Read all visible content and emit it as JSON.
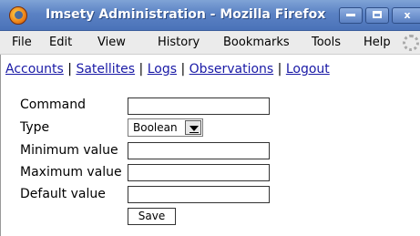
{
  "window": {
    "title": "Imsety Administration - Mozilla Firefox",
    "controls": [
      "minimize-icon",
      "maximize-icon",
      "close-icon"
    ],
    "close_glyph": "x"
  },
  "menubar": {
    "items": [
      "File",
      "Edit",
      "View",
      "History",
      "Bookmarks",
      "Tools",
      "Help"
    ]
  },
  "nav": {
    "links": [
      "Accounts",
      "Satellites",
      "Logs",
      "Observations",
      "Logout"
    ],
    "separator": "|"
  },
  "form": {
    "command_label": "Command",
    "command_value": "",
    "type_label": "Type",
    "type_selected": "Boolean",
    "min_label": "Minimum value",
    "min_value": "",
    "max_label": "Maximum value",
    "max_value": "",
    "default_label": "Default value",
    "default_value": "",
    "save_label": "Save"
  },
  "colors": {
    "titlebar": "#5b82c4",
    "link": "#1a1aa6",
    "menubar": "#ebebeb"
  }
}
